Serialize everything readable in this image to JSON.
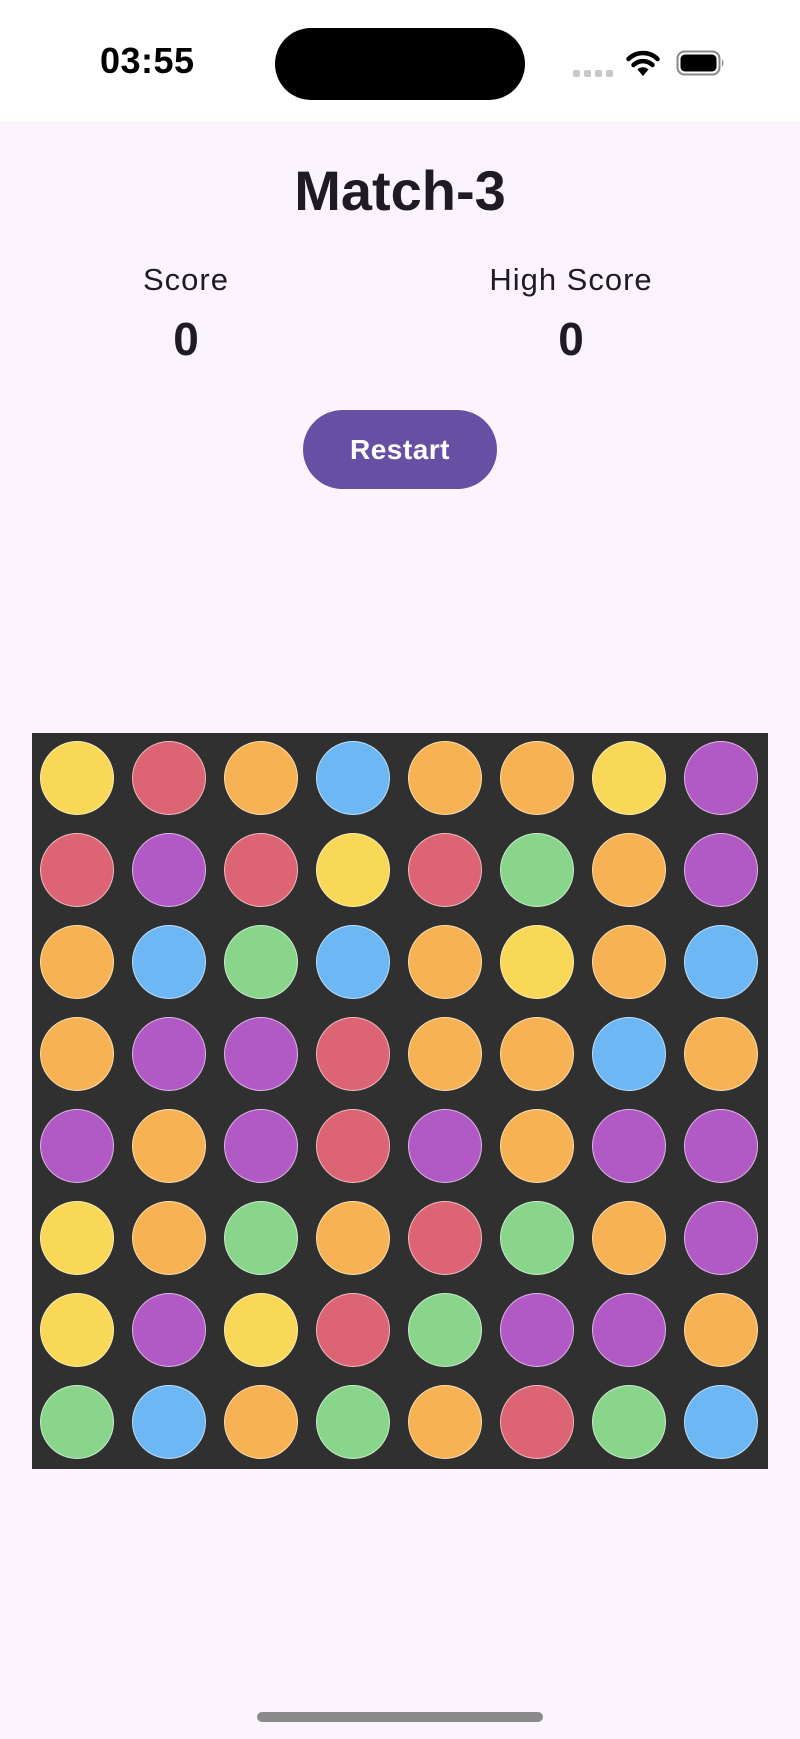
{
  "status_bar": {
    "time": "03:55"
  },
  "title": "Match-3",
  "score": {
    "label": "Score",
    "value": "0"
  },
  "high_score": {
    "label": "High Score",
    "value": "0"
  },
  "restart_label": "Restart",
  "colors": {
    "background": "#fcf4fc",
    "button": "#6750a4",
    "board": "#303030",
    "yellow": "#f9d857",
    "red": "#dc6474",
    "orange": "#f7b353",
    "blue": "#6db8f4",
    "purple": "#b15ac6",
    "green": "#88d58b"
  },
  "board": {
    "rows": 8,
    "cols": 8,
    "grid": [
      [
        "yellow",
        "red",
        "orange",
        "blue",
        "orange",
        "orange",
        "yellow",
        "purple"
      ],
      [
        "red",
        "purple",
        "red",
        "yellow",
        "red",
        "green",
        "orange",
        "purple"
      ],
      [
        "orange",
        "blue",
        "green",
        "blue",
        "orange",
        "yellow",
        "orange",
        "blue"
      ],
      [
        "orange",
        "purple",
        "purple",
        "red",
        "orange",
        "orange",
        "blue",
        "orange"
      ],
      [
        "purple",
        "orange",
        "purple",
        "red",
        "purple",
        "orange",
        "purple",
        "purple"
      ],
      [
        "yellow",
        "orange",
        "green",
        "orange",
        "red",
        "green",
        "orange",
        "purple"
      ],
      [
        "yellow",
        "purple",
        "yellow",
        "red",
        "green",
        "purple",
        "purple",
        "orange"
      ],
      [
        "green",
        "blue",
        "orange",
        "green",
        "orange",
        "red",
        "green",
        "blue"
      ]
    ]
  }
}
